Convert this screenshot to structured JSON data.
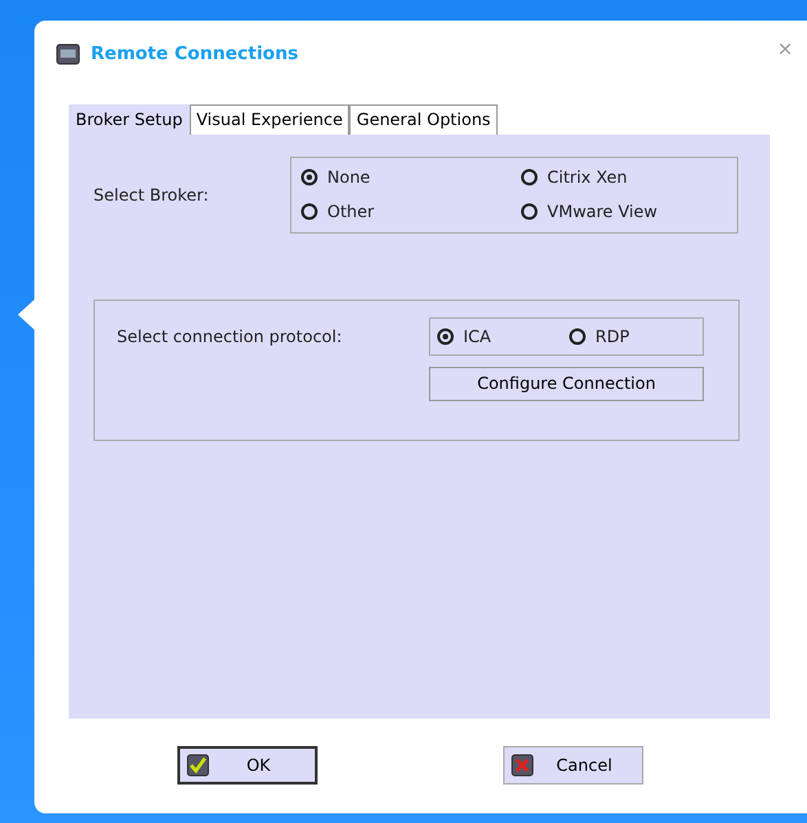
{
  "window": {
    "title": "Remote Connections",
    "close": "×"
  },
  "tabs": [
    {
      "label": "Broker Setup",
      "selected": true
    },
    {
      "label": "Visual Experience",
      "selected": false
    },
    {
      "label": "General Options",
      "selected": false
    }
  ],
  "broker": {
    "label": "Select Broker:",
    "options": [
      {
        "label": "None",
        "selected": true
      },
      {
        "label": "Citrix Xen",
        "selected": false
      },
      {
        "label": "Other",
        "selected": false
      },
      {
        "label": "VMware View",
        "selected": false
      }
    ]
  },
  "protocol": {
    "label": "Select connection protocol:",
    "options": [
      {
        "label": "ICA",
        "selected": true
      },
      {
        "label": "RDP",
        "selected": false
      }
    ],
    "button": {
      "label": "Configure Connection"
    }
  },
  "buttons": [
    {
      "kind": "ok",
      "label": "OK",
      "default": true
    },
    {
      "kind": "cancel",
      "label": "Cancel",
      "default": false
    }
  ]
}
